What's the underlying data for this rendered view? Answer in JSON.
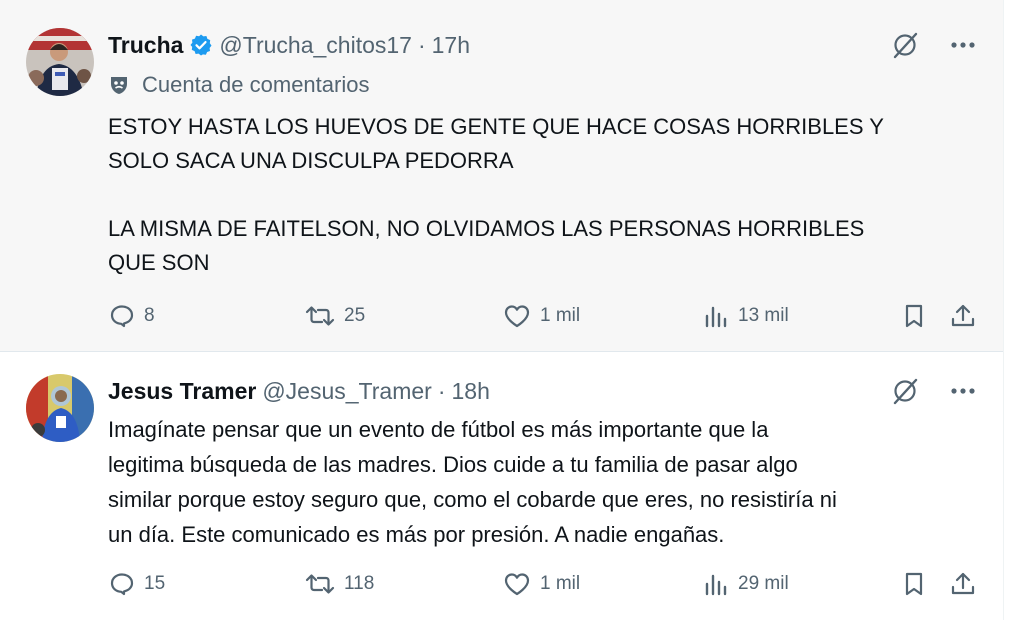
{
  "colors": {
    "text_primary": "#0f1419",
    "text_secondary": "#536471",
    "verified_blue": "#1d9bf0",
    "selected_bg": "#f7f7f7"
  },
  "tweets": [
    {
      "name": "Trucha",
      "verified": true,
      "handle": "@Trucha_chitos17",
      "separator": "·",
      "time": "17h",
      "community_label": "Cuenta de comentarios",
      "body": [
        "ESTOY HASTA LOS HUEVOS DE GENTE QUE HACE COSAS HORRIBLES Y\nSOLO SACA UNA DISCULPA PEDORRA",
        "LA MISMA DE FAITELSON, NO OLVIDAMOS LAS PERSONAS HORRIBLES\nQUE SON"
      ],
      "stats": {
        "replies": "8",
        "reposts": "25",
        "likes": "1 mil",
        "views": "13 mil"
      },
      "icons": [
        "grok-icon",
        "more-icon",
        "mask-icon",
        "reply-icon",
        "repost-icon",
        "like-icon",
        "views-icon",
        "bookmark-icon",
        "share-icon"
      ]
    },
    {
      "name": "Jesus Tramer",
      "verified": false,
      "handle": "@Jesus_Tramer",
      "separator": "·",
      "time": "18h",
      "body": [
        "Imagínate pensar que un evento de fútbol es más importante que la\nlegitima búsqueda de las madres. Dios cuide a tu familia de pasar algo\nsimilar porque estoy seguro que, como el cobarde que eres, no resistiría ni\nun día. Este comunicado es más por presión. A nadie engañas."
      ],
      "stats": {
        "replies": "15",
        "reposts": "118",
        "likes": "1 mil",
        "views": "29 mil"
      },
      "icons": [
        "grok-icon",
        "more-icon",
        "reply-icon",
        "repost-icon",
        "like-icon",
        "views-icon",
        "bookmark-icon",
        "share-icon"
      ]
    }
  ]
}
